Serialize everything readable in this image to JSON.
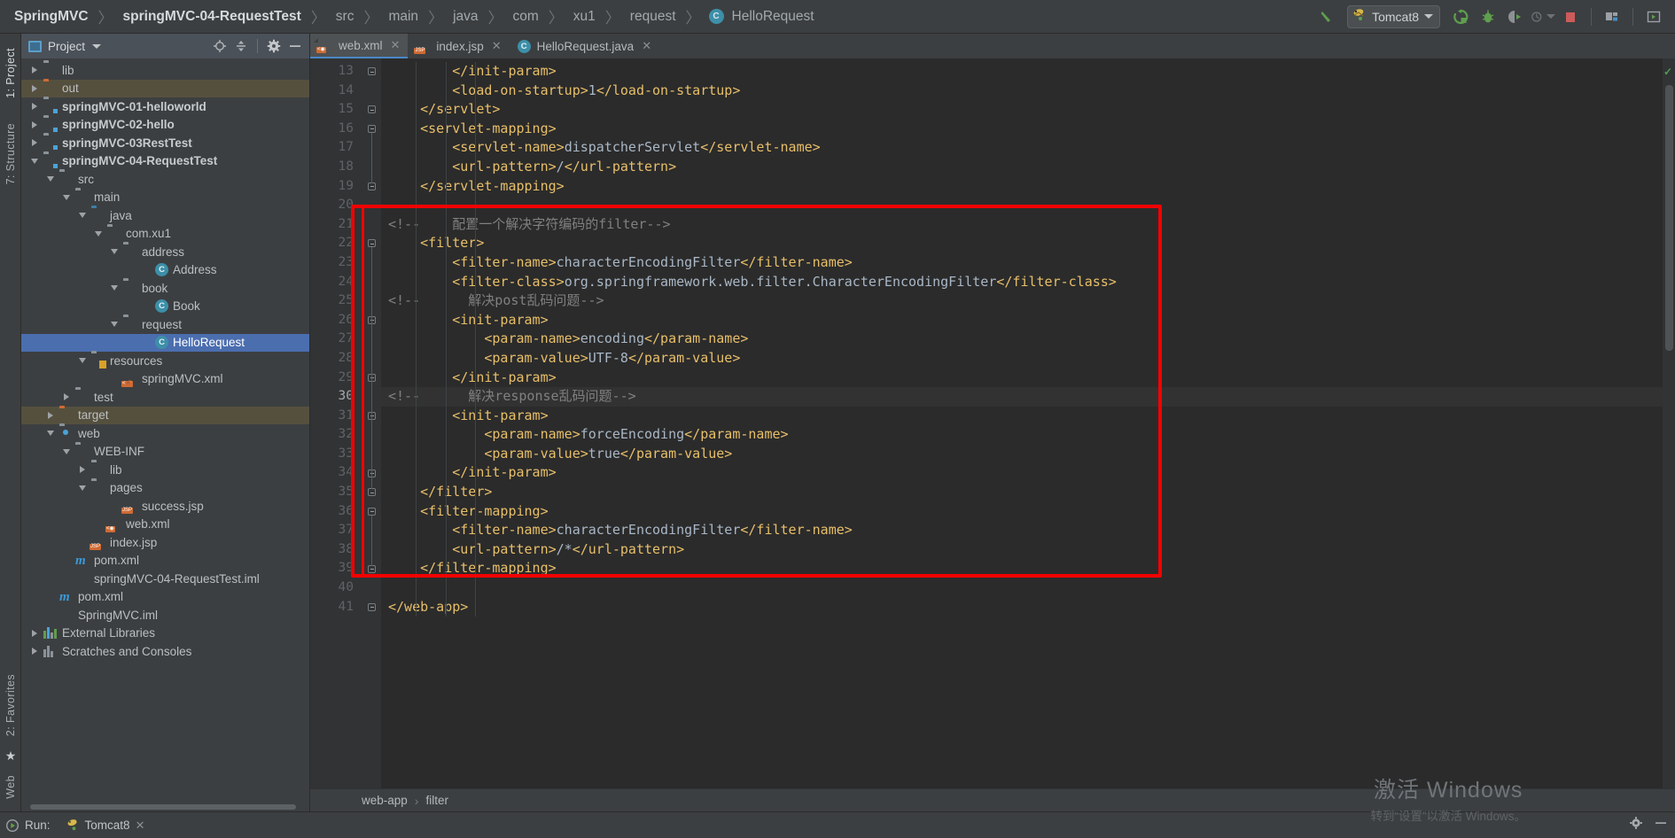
{
  "window": {
    "breadcrumbs": [
      {
        "label": "SpringMVC",
        "bold": true,
        "icon": null
      },
      {
        "label": "springMVC-04-RequestTest",
        "bold": true,
        "icon": null
      },
      {
        "label": "src",
        "bold": false,
        "icon": null
      },
      {
        "label": "main",
        "bold": false,
        "icon": null
      },
      {
        "label": "java",
        "bold": false,
        "icon": null
      },
      {
        "label": "com",
        "bold": false,
        "icon": null
      },
      {
        "label": "xu1",
        "bold": false,
        "icon": null
      },
      {
        "label": "request",
        "bold": false,
        "icon": null
      },
      {
        "label": "HelloRequest",
        "bold": false,
        "icon": "class-icon"
      }
    ],
    "separator": "〉"
  },
  "toolbar": {
    "build_icon": "build-hammer-icon",
    "run_config": {
      "label": "Tomcat8",
      "icon": "tomcat-icon",
      "caret": "chevron-down-icon"
    },
    "buttons": [
      {
        "name": "run-button",
        "icon": "run-icon"
      },
      {
        "name": "debug-button",
        "icon": "debug-bug-icon"
      },
      {
        "name": "run-with-coverage-button",
        "icon": "coverage-icon"
      },
      {
        "name": "profile-button",
        "icon": "profiler-icon"
      },
      {
        "name": "stop-button",
        "icon": "stop-square-icon"
      },
      {
        "name": "project-structure-button",
        "icon": "project-structure-icon"
      },
      {
        "name": "restore-layout-button",
        "icon": "layout-icon"
      }
    ],
    "accent_green": "#5f9e4f",
    "stop_red": "#cc5b5b"
  },
  "left_strip": {
    "tabs": [
      {
        "label": "1: Project",
        "selected": true
      },
      {
        "label": "7: Structure",
        "selected": false
      }
    ],
    "bottom_tabs": [
      {
        "label": "2: Favorites",
        "icon": "star-icon"
      },
      {
        "label": "Web",
        "icon": "web-icon"
      }
    ]
  },
  "project_panel": {
    "title": "Project",
    "title_icon": "project-window-icon",
    "caret": "chevron-down-icon",
    "header_buttons": [
      {
        "name": "scroll-from-source-button",
        "icon": "target-icon"
      },
      {
        "name": "collapse-all-button",
        "icon": "collapse-all-icon"
      },
      {
        "name": "settings-button",
        "icon": "gear-icon"
      },
      {
        "name": "hide-button",
        "icon": "minimize-icon"
      }
    ],
    "tree": [
      {
        "label": "lib",
        "indent": 1,
        "twisty": "right",
        "icon": "folder",
        "bold": false
      },
      {
        "label": "out",
        "indent": 1,
        "twisty": "right",
        "icon": "folder-orange",
        "bold": false,
        "excluded": true
      },
      {
        "label": "springMVC-01-helloworld",
        "indent": 1,
        "twisty": "right",
        "icon": "module",
        "bold": true
      },
      {
        "label": "springMVC-02-hello",
        "indent": 1,
        "twisty": "right",
        "icon": "module",
        "bold": true
      },
      {
        "label": "springMVC-03RestTest",
        "indent": 1,
        "twisty": "right",
        "icon": "module",
        "bold": true
      },
      {
        "label": "springMVC-04-RequestTest",
        "indent": 1,
        "twisty": "down",
        "icon": "module",
        "bold": true
      },
      {
        "label": "src",
        "indent": 2,
        "twisty": "down",
        "icon": "folder",
        "bold": false
      },
      {
        "label": "main",
        "indent": 3,
        "twisty": "down",
        "icon": "folder",
        "bold": false
      },
      {
        "label": "java",
        "indent": 4,
        "twisty": "down",
        "icon": "folder-source",
        "bold": false
      },
      {
        "label": "com.xu1",
        "indent": 5,
        "twisty": "down",
        "icon": "package",
        "bold": false
      },
      {
        "label": "address",
        "indent": 6,
        "twisty": "down",
        "icon": "package",
        "bold": false
      },
      {
        "label": "Address",
        "indent": 8,
        "twisty": "none",
        "icon": "class",
        "bold": false
      },
      {
        "label": "book",
        "indent": 6,
        "twisty": "down",
        "icon": "package",
        "bold": false
      },
      {
        "label": "Book",
        "indent": 8,
        "twisty": "none",
        "icon": "class",
        "bold": false
      },
      {
        "label": "request",
        "indent": 6,
        "twisty": "down",
        "icon": "package",
        "bold": false
      },
      {
        "label": "HelloRequest",
        "indent": 8,
        "twisty": "none",
        "icon": "class",
        "bold": false,
        "selected": true
      },
      {
        "label": "resources",
        "indent": 4,
        "twisty": "down",
        "icon": "folder-resources",
        "bold": false
      },
      {
        "label": "springMVC.xml",
        "indent": 6,
        "twisty": "none",
        "icon": "file-springxml",
        "bold": false
      },
      {
        "label": "test",
        "indent": 3,
        "twisty": "right",
        "icon": "folder",
        "bold": false
      },
      {
        "label": "target",
        "indent": 2,
        "twisty": "right",
        "icon": "folder-orange",
        "bold": false,
        "excluded": true
      },
      {
        "label": "web",
        "indent": 2,
        "twisty": "down",
        "icon": "folder-web",
        "bold": false
      },
      {
        "label": "WEB-INF",
        "indent": 3,
        "twisty": "down",
        "icon": "folder",
        "bold": false
      },
      {
        "label": "lib",
        "indent": 4,
        "twisty": "right",
        "icon": "folder",
        "bold": false
      },
      {
        "label": "pages",
        "indent": 4,
        "twisty": "down",
        "icon": "folder",
        "bold": false
      },
      {
        "label": "success.jsp",
        "indent": 6,
        "twisty": "none",
        "icon": "file-jsp",
        "bold": false
      },
      {
        "label": "web.xml",
        "indent": 5,
        "twisty": "none",
        "icon": "file-webxml",
        "bold": false
      },
      {
        "label": "index.jsp",
        "indent": 4,
        "twisty": "none",
        "icon": "file-jsp",
        "bold": false
      },
      {
        "label": "pom.xml",
        "indent": 3,
        "twisty": "none",
        "icon": "file-maven",
        "bold": false
      },
      {
        "label": "springMVC-04-RequestTest.iml",
        "indent": 3,
        "twisty": "none",
        "icon": "file-iml",
        "bold": false
      },
      {
        "label": "pom.xml",
        "indent": 2,
        "twisty": "none",
        "icon": "file-maven",
        "bold": false
      },
      {
        "label": "SpringMVC.iml",
        "indent": 2,
        "twisty": "none",
        "icon": "file-iml",
        "bold": false
      },
      {
        "label": "External Libraries",
        "indent": 1,
        "twisty": "right",
        "icon": "libraries",
        "bold": false
      },
      {
        "label": "Scratches and Consoles",
        "indent": 1,
        "twisty": "right",
        "icon": "scratches",
        "bold": false
      }
    ]
  },
  "editor": {
    "tabs": [
      {
        "label": "web.xml",
        "icon": "webxml-file-icon",
        "active": true,
        "closable": true
      },
      {
        "label": "index.jsp",
        "icon": "jsp-file-icon",
        "active": false,
        "closable": true
      },
      {
        "label": "HelloRequest.java",
        "icon": "class-icon",
        "active": false,
        "closable": true
      }
    ],
    "first_line_number": 13,
    "current_line": 30,
    "lines": [
      {
        "n": 13,
        "indent": 2,
        "fold": "close",
        "segments": [
          {
            "t": "tag",
            "v": "</init-param>"
          }
        ]
      },
      {
        "n": 14,
        "indent": 2,
        "fold": "none",
        "segments": [
          {
            "t": "tag",
            "v": "<load-on-startup>"
          },
          {
            "t": "txt",
            "v": "1"
          },
          {
            "t": "tag",
            "v": "</load-on-startup>"
          }
        ]
      },
      {
        "n": 15,
        "indent": 1,
        "fold": "close",
        "segments": [
          {
            "t": "tag",
            "v": "</servlet>"
          }
        ]
      },
      {
        "n": 16,
        "indent": 1,
        "fold": "open",
        "segments": [
          {
            "t": "tag",
            "v": "<servlet-mapping>"
          }
        ]
      },
      {
        "n": 17,
        "indent": 2,
        "fold": "none",
        "segments": [
          {
            "t": "tag",
            "v": "<servlet-name>"
          },
          {
            "t": "txt",
            "v": "dispatcherServlet"
          },
          {
            "t": "tag",
            "v": "</servlet-name>"
          }
        ]
      },
      {
        "n": 18,
        "indent": 2,
        "fold": "none",
        "segments": [
          {
            "t": "tag",
            "v": "<url-pattern>"
          },
          {
            "t": "txt",
            "v": "/"
          },
          {
            "t": "tag",
            "v": "</url-pattern>"
          }
        ]
      },
      {
        "n": 19,
        "indent": 1,
        "fold": "close",
        "segments": [
          {
            "t": "tag",
            "v": "</servlet-mapping>"
          }
        ]
      },
      {
        "n": 20,
        "indent": 0,
        "fold": "none",
        "segments": []
      },
      {
        "n": 21,
        "indent": 0,
        "fold": "none",
        "segments": [
          {
            "t": "cmt",
            "v": "<!--    配置一个解决字符编码的filter-->"
          }
        ]
      },
      {
        "n": 22,
        "indent": 1,
        "fold": "open",
        "segments": [
          {
            "t": "tag",
            "v": "<filter>"
          }
        ]
      },
      {
        "n": 23,
        "indent": 2,
        "fold": "none",
        "segments": [
          {
            "t": "tag",
            "v": "<filter-name>"
          },
          {
            "t": "txt",
            "v": "characterEncodingFilter"
          },
          {
            "t": "tag",
            "v": "</filter-name>"
          }
        ]
      },
      {
        "n": 24,
        "indent": 2,
        "fold": "none",
        "segments": [
          {
            "t": "tag",
            "v": "<filter-class>"
          },
          {
            "t": "txt",
            "v": "org.springframework.web.filter.CharacterEncodingFilter"
          },
          {
            "t": "tag",
            "v": "</filter-class>"
          }
        ]
      },
      {
        "n": 25,
        "indent": 0,
        "fold": "none",
        "segments": [
          {
            "t": "cmt",
            "v": "<!--      解决post乱码问题-->"
          }
        ]
      },
      {
        "n": 26,
        "indent": 2,
        "fold": "open",
        "segments": [
          {
            "t": "tag",
            "v": "<init-param>"
          }
        ]
      },
      {
        "n": 27,
        "indent": 3,
        "fold": "none",
        "segments": [
          {
            "t": "tag",
            "v": "<param-name>"
          },
          {
            "t": "txt",
            "v": "encoding"
          },
          {
            "t": "tag",
            "v": "</param-name>"
          }
        ]
      },
      {
        "n": 28,
        "indent": 3,
        "fold": "none",
        "segments": [
          {
            "t": "tag",
            "v": "<param-value>"
          },
          {
            "t": "txt",
            "v": "UTF-8"
          },
          {
            "t": "tag",
            "v": "</param-value>"
          }
        ]
      },
      {
        "n": 29,
        "indent": 2,
        "fold": "close",
        "segments": [
          {
            "t": "tag",
            "v": "</init-param>"
          }
        ]
      },
      {
        "n": 30,
        "indent": 0,
        "fold": "none",
        "segments": [
          {
            "t": "cmt",
            "v": "<!--      解决response乱码问题-->"
          }
        ]
      },
      {
        "n": 31,
        "indent": 2,
        "fold": "open",
        "segments": [
          {
            "t": "tag",
            "v": "<init-param>"
          }
        ]
      },
      {
        "n": 32,
        "indent": 3,
        "fold": "none",
        "segments": [
          {
            "t": "tag",
            "v": "<param-name>"
          },
          {
            "t": "txt",
            "v": "forceEncoding"
          },
          {
            "t": "tag",
            "v": "</param-name>"
          }
        ]
      },
      {
        "n": 33,
        "indent": 3,
        "fold": "none",
        "segments": [
          {
            "t": "tag",
            "v": "<param-value>"
          },
          {
            "t": "txt",
            "v": "true"
          },
          {
            "t": "tag",
            "v": "</param-value>"
          }
        ]
      },
      {
        "n": 34,
        "indent": 2,
        "fold": "close",
        "segments": [
          {
            "t": "tag",
            "v": "</init-param>"
          }
        ]
      },
      {
        "n": 35,
        "indent": 1,
        "fold": "close",
        "segments": [
          {
            "t": "tag",
            "v": "</filter>"
          }
        ]
      },
      {
        "n": 36,
        "indent": 1,
        "fold": "open",
        "segments": [
          {
            "t": "tag",
            "v": "<filter-mapping>"
          }
        ]
      },
      {
        "n": 37,
        "indent": 2,
        "fold": "none",
        "segments": [
          {
            "t": "tag",
            "v": "<filter-name>"
          },
          {
            "t": "txt",
            "v": "characterEncodingFilter"
          },
          {
            "t": "tag",
            "v": "</filter-name>"
          }
        ]
      },
      {
        "n": 38,
        "indent": 2,
        "fold": "none",
        "segments": [
          {
            "t": "tag",
            "v": "<url-pattern>"
          },
          {
            "t": "txt",
            "v": "/*"
          },
          {
            "t": "tag",
            "v": "</url-pattern>"
          }
        ]
      },
      {
        "n": 39,
        "indent": 1,
        "fold": "close",
        "segments": [
          {
            "t": "tag",
            "v": "</filter-mapping>"
          }
        ]
      },
      {
        "n": 40,
        "indent": 0,
        "fold": "none",
        "segments": []
      },
      {
        "n": 41,
        "indent": 0,
        "fold": "close",
        "segments": [
          {
            "t": "tag",
            "v": "</web-app>"
          }
        ]
      }
    ],
    "annotation": {
      "shape": "rectangle",
      "color": "#f50000",
      "from_line": 21,
      "to_line": 39
    },
    "crumbs": [
      "web-app",
      "filter"
    ],
    "crumb_separator": "›",
    "inspection_status": "ok"
  },
  "bottom_bar": {
    "run_label": "Run:",
    "run_icon": "run-icon",
    "config_name": "Tomcat8",
    "config_icon": "tomcat-icon",
    "close_icon": "close-icon",
    "right_icons": [
      {
        "name": "settings-gear-icon"
      },
      {
        "name": "minimize-icon"
      }
    ]
  },
  "watermark": {
    "line1": "激活 Windows",
    "line2": "转到“设置”以激活 Windows。"
  },
  "colors": {
    "bg_panel": "#3c3f41",
    "bg_editor": "#2b2b2b",
    "gutter": "#313335",
    "selection_blue": "#4b6eaf",
    "excluded_olive": "#55503e",
    "tag_gold": "#e8bf6a",
    "text_code": "#a9b7c6",
    "comment_gray": "#808080",
    "annotation_red": "#f50000"
  }
}
